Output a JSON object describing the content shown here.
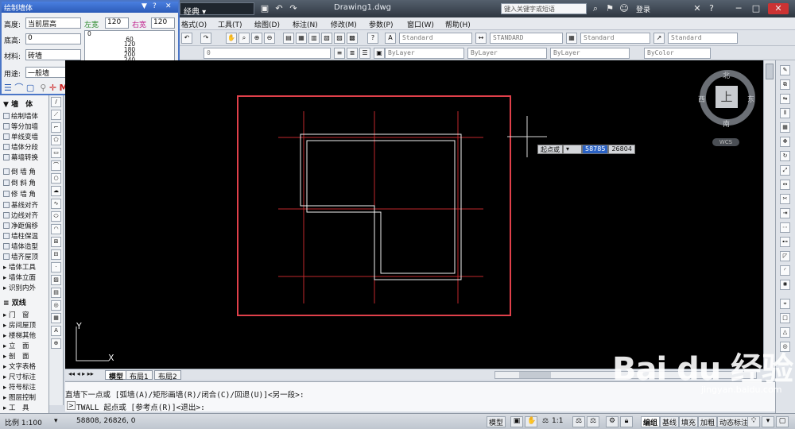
{
  "app": {
    "title": "Drawing1.dwg",
    "workspace": "经典",
    "search_placeholder": "键入关键字或短语",
    "login": "登录"
  },
  "menus": [
    "格式(O)",
    "工具(T)",
    "绘图(D)",
    "标注(N)",
    "修改(M)",
    "参数(P)",
    "窗口(W)",
    "帮助(H)"
  ],
  "toolbar": {
    "text_style": "Standard",
    "dim_style": "STANDARD",
    "table_style": "Standard",
    "mleader_style": "Standard",
    "layer": "0",
    "color": "ByLayer",
    "linetype": "ByLayer",
    "lineweight": "ByLayer",
    "plotstyle": "ByColor"
  },
  "wall_panel": {
    "title": "绘制墙体",
    "height_label": "高度:",
    "height_value": "当前层高",
    "left_width_label": "左宽",
    "left_width_value": "120",
    "right_width_label": "右宽",
    "right_width_value": "120",
    "base_label": "底高:",
    "base_value": "0",
    "material_label": "材料:",
    "material_value": "砖墙",
    "usage_label": "用途:",
    "usage_value": "一般墙",
    "width_list": [
      "0",
      "60",
      "120",
      "180",
      "200",
      "240"
    ],
    "buttons": [
      "左",
      "中",
      "右",
      "交换"
    ]
  },
  "left_menu": {
    "section1": "墙　体",
    "items": [
      "绘制墙体",
      "等分加墙",
      "单线变墙",
      "墙体分段",
      "幕墙转换",
      "倒 墙 角",
      "倒 斜 角",
      "修 墙 角",
      "基线对齐",
      "边线对齐",
      "净距偏移",
      "墙柱保温",
      "墙体造型",
      "墙齐屋顶",
      "墙体工具",
      "墙体立面",
      "识别内外"
    ],
    "section2": "双线",
    "items2": [
      "门　窗",
      "房间屋顶",
      "楼梯其他",
      "立　面",
      "剖　面",
      "文字表格",
      "尺寸标注",
      "符号标注",
      "图层控制",
      "工　具"
    ]
  },
  "viewcube": {
    "top": "上",
    "north": "北",
    "south": "南",
    "east": "东",
    "west": "西",
    "wcs": "WCS"
  },
  "dynamic_input": {
    "label": "起点或",
    "x": "58785",
    "y": "26804"
  },
  "ucs": {
    "x": "X",
    "y": "Y"
  },
  "tabs": [
    "模型",
    "布局1",
    "布局2"
  ],
  "command": {
    "line1": "直墙下一点或 [弧墙(A)/矩形画墙(R)/闭合(C)/回退(U)]<另一段>:",
    "line2": "TWALL 起点或 [参考点(R)]<退出>:"
  },
  "status": {
    "scale": "比例 1:100",
    "coords": "58808, 26826, 0",
    "model": "模型",
    "annoscale": "1:1",
    "buttons": [
      "编组",
      "基线",
      "填充",
      "加粗",
      "动态标注"
    ]
  },
  "watermark": {
    "text": "Bai du 经验",
    "url": "jingyan.baidu.com"
  },
  "colors": {
    "border_red": "#e0404a",
    "axis_red": "#c0282c",
    "wall": "#f2f2f2"
  }
}
